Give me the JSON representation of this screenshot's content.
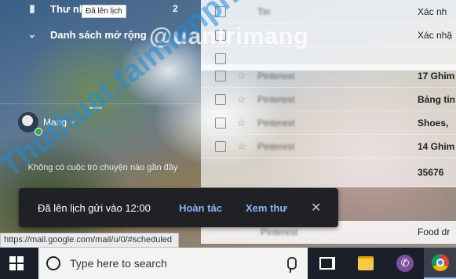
{
  "sidebar": {
    "items": [
      {
        "icon": "file-icon",
        "label": "Thư nh",
        "count": "2"
      },
      {
        "icon": "chevron-down-icon",
        "label": "Danh sách mở rộng"
      }
    ],
    "tooltip": "Đã lên lịch",
    "hangouts": {
      "name": "Mang",
      "dropdown_icon": "caret-down-icon"
    },
    "no_conversations": "Không có cuộc trò chuyện nào gần đây"
  },
  "mail_list": {
    "rows": [
      {
        "sender": "Tin",
        "subject": "Xác nh",
        "state": "read"
      },
      {
        "sender": "",
        "subject": "Xác nhậ",
        "state": "read"
      },
      {
        "sender": "",
        "subject": "",
        "state": "read"
      },
      {
        "sender": "Pinterest",
        "subject": "17 Ghim",
        "state": "unread"
      },
      {
        "sender": "Pinterest",
        "subject": "Bảng tin",
        "state": "unread"
      },
      {
        "sender": "Pinterest",
        "subject": "Shoes,",
        "state": "unread"
      },
      {
        "sender": "Pinterest",
        "subject": "14 Ghim",
        "state": "unread"
      },
      {
        "sender": "",
        "subject": "35676",
        "state": "unread"
      },
      {
        "sender": "Pinterest",
        "subject": "Food dr",
        "state": "read"
      }
    ]
  },
  "snackbar": {
    "message": "Đã lên lịch gửi vào 12:00",
    "undo": "Hoàn tác",
    "view": "Xem thư",
    "close_icon": "close-icon"
  },
  "status_url": "https://mail.google.com/mail/u/0/#scheduled",
  "taskbar": {
    "search_placeholder": "Type here to search",
    "icons": [
      "windows-start-icon",
      "search-icon",
      "microphone-icon",
      "task-view-icon",
      "file-explorer-icon",
      "viber-icon",
      "chrome-icon"
    ]
  },
  "watermarks": {
    "top": "@uantrimang",
    "diagonal": "Thuthuat.taimienphi.vn"
  },
  "colors": {
    "snackbar_bg": "#202124",
    "snackbar_action": "#8ab4f8",
    "online": "#34a853"
  }
}
